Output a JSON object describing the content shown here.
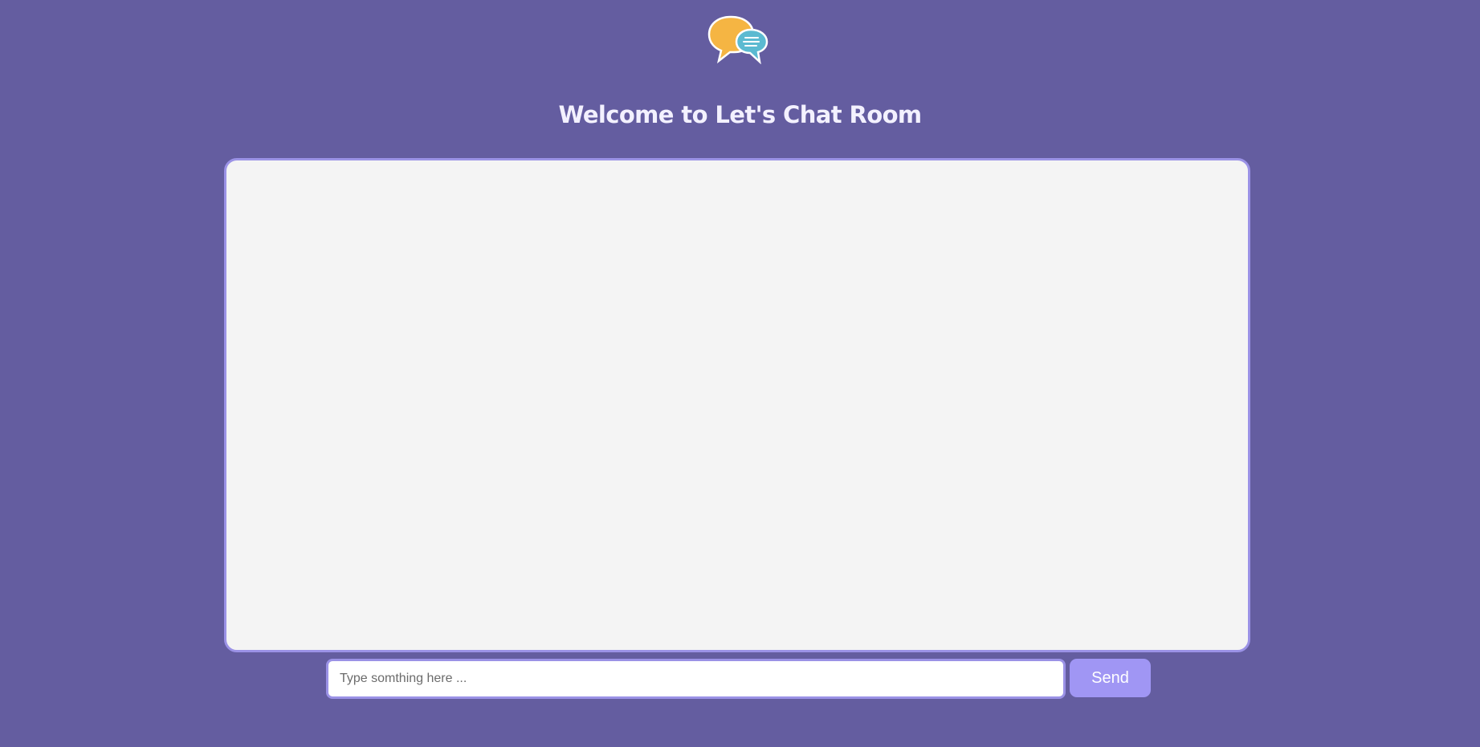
{
  "header": {
    "logo_icon": "chat-bubbles-icon",
    "title": "Welcome to Let's Chat Room"
  },
  "chat": {
    "messages": []
  },
  "composer": {
    "placeholder": "Type somthing here ...",
    "value": "",
    "send_label": "Send"
  },
  "colors": {
    "background": "#645da0",
    "accent": "#9b92e6",
    "button": "#a096f4",
    "chat_background": "#f4f4f4",
    "logo_orange": "#f5b543",
    "logo_teal": "#5bbad1"
  }
}
